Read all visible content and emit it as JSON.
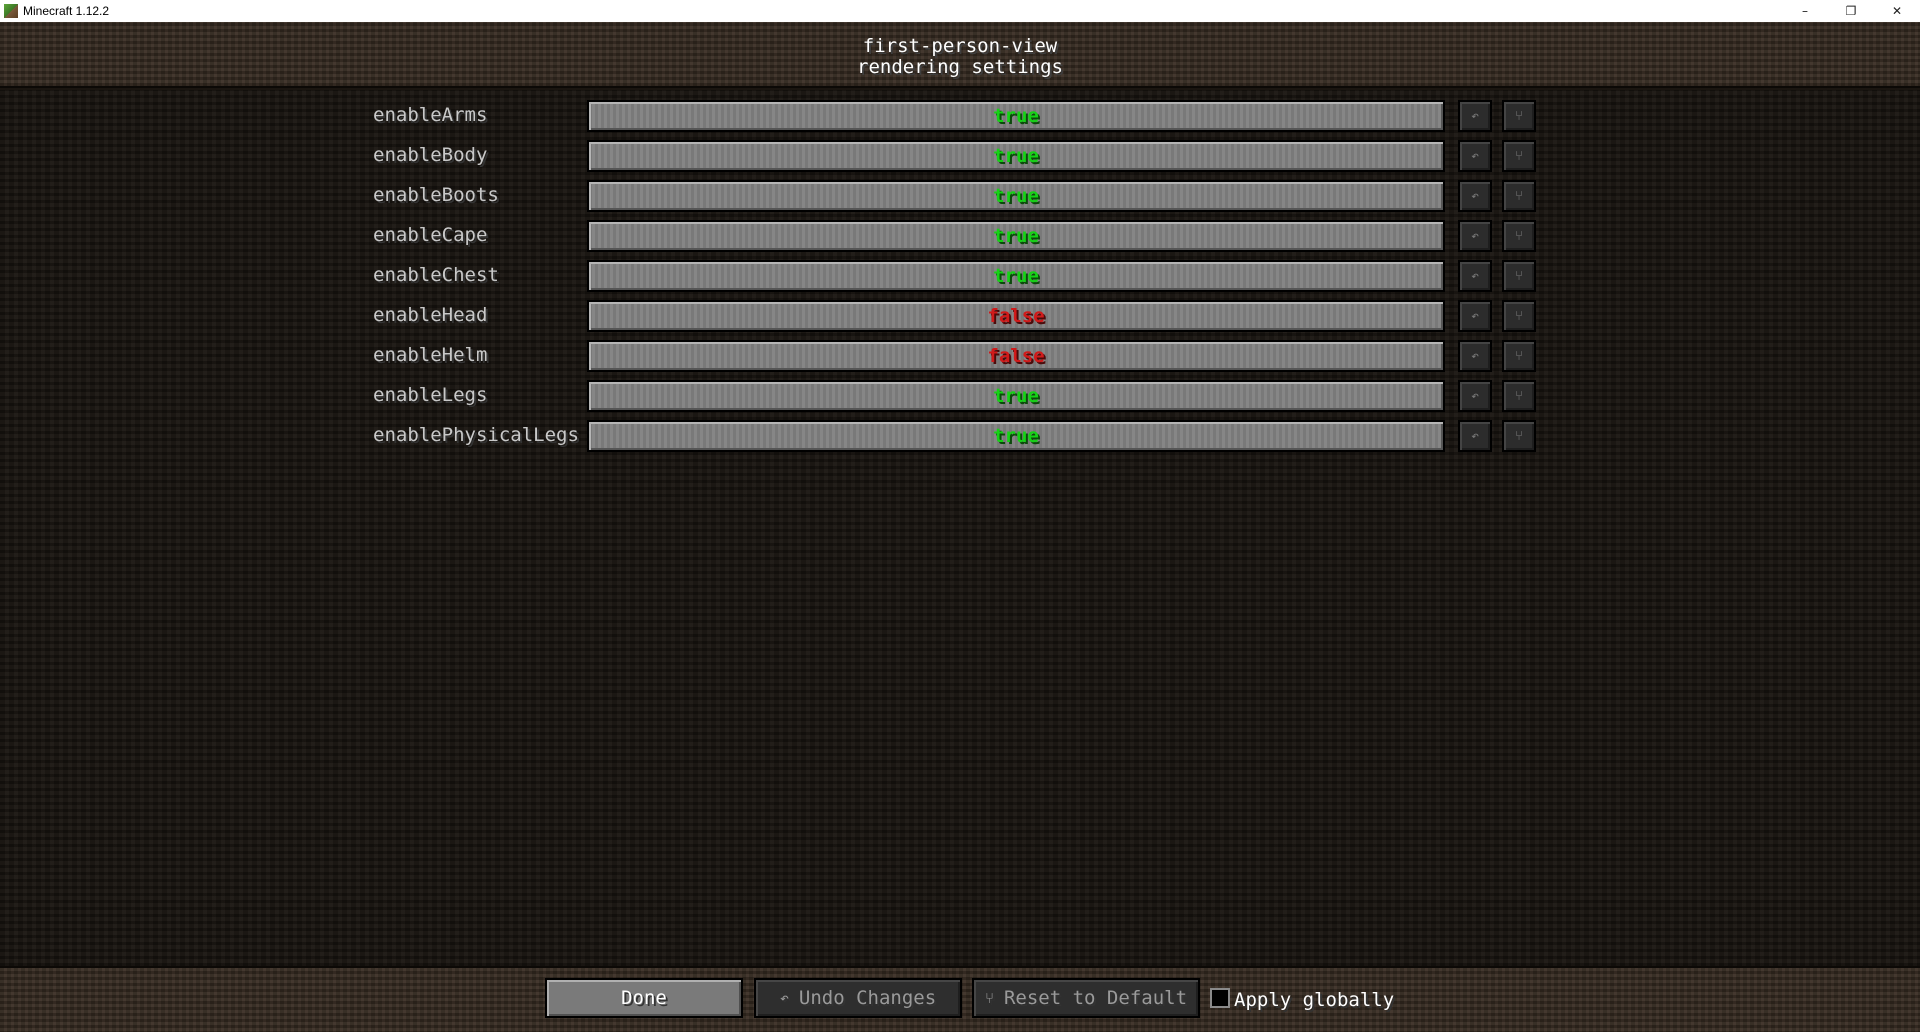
{
  "window": {
    "title": "Minecraft 1.12.2",
    "controls": {
      "minimize": "–",
      "maximize": "❐",
      "close": "✕"
    }
  },
  "header": {
    "line1": "first-person-view",
    "line2": "rendering settings"
  },
  "settings": [
    {
      "name": "enableArms",
      "value": "true"
    },
    {
      "name": "enableBody",
      "value": "true"
    },
    {
      "name": "enableBoots",
      "value": "true"
    },
    {
      "name": "enableCape",
      "value": "true"
    },
    {
      "name": "enableChest",
      "value": "true"
    },
    {
      "name": "enableHead",
      "value": "false"
    },
    {
      "name": "enableHelm",
      "value": "false"
    },
    {
      "name": "enableLegs",
      "value": "true"
    },
    {
      "name": "enablePhysicalLegs",
      "value": "true"
    }
  ],
  "row_icons": {
    "undo": "↶",
    "reset": "⑂"
  },
  "footer": {
    "done_label": "Done",
    "undo_label": "Undo Changes",
    "undo_icon": "↶",
    "reset_label": "Reset to Default",
    "reset_icon": "⑂",
    "apply_globally_label": "Apply globally",
    "apply_globally_checked": false
  },
  "colors": {
    "true_value": "#16d216",
    "false_value": "#d01a1a"
  }
}
